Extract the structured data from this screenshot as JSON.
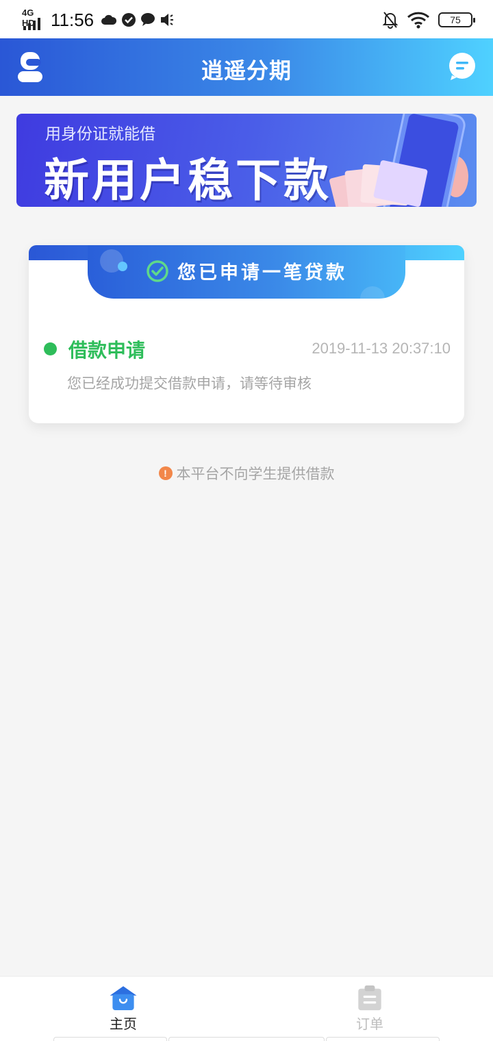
{
  "status_bar": {
    "network": "4G HD",
    "time": "11:56",
    "battery": "75",
    "icons": [
      "cloud-icon",
      "check-circle-icon",
      "chat-bubble-icon",
      "volume-icon",
      "bell-off-icon",
      "wifi-icon",
      "battery-icon"
    ]
  },
  "header": {
    "title": "逍遥分期",
    "left_icon": "user-avatar-icon",
    "right_icon": "message-icon"
  },
  "banner": {
    "subtitle": "用身份证就能借",
    "title": "新用户稳下款"
  },
  "application_card": {
    "ribbon_text": "您已申请一笔贷款",
    "status_title": "借款申请",
    "timestamp": "2019-11-13 20:37:10",
    "description": "您已经成功提交借款申请，请等待审核"
  },
  "notice": {
    "text": "本平台不向学生提供借款"
  },
  "bottom_nav": {
    "items": [
      {
        "label": "主页",
        "icon": "home-icon",
        "active": true
      },
      {
        "label": "订单",
        "icon": "clipboard-icon",
        "active": false
      }
    ]
  },
  "colors": {
    "brand_gradient_start": "#2a57d6",
    "brand_gradient_end": "#4fd1ff",
    "success_green": "#2ebd5a",
    "warning_orange": "#f2874a"
  }
}
